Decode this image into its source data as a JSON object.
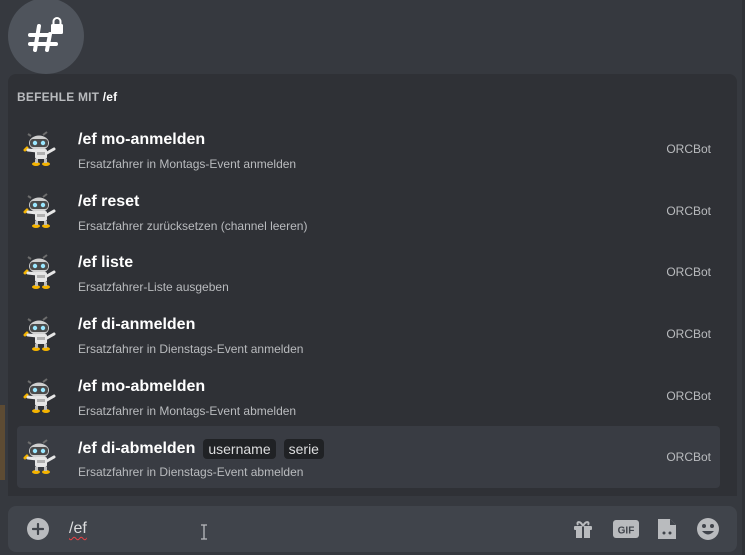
{
  "channel": {
    "icon": "hashtag-lock-icon"
  },
  "popup": {
    "header_prefix": "BEFEHLE MIT",
    "header_query": "/ef",
    "commands": [
      {
        "name": "/ef mo-anmelden",
        "description": "Ersatzfahrer in Montags-Event anmelden",
        "bot": "ORCBot",
        "options": []
      },
      {
        "name": "/ef reset",
        "description": "Ersatzfahrer zurücksetzen (channel leeren)",
        "bot": "ORCBot",
        "options": []
      },
      {
        "name": "/ef liste",
        "description": "Ersatzfahrer-Liste ausgeben",
        "bot": "ORCBot",
        "options": []
      },
      {
        "name": "/ef di-anmelden",
        "description": "Ersatzfahrer in Dienstags-Event anmelden",
        "bot": "ORCBot",
        "options": []
      },
      {
        "name": "/ef mo-abmelden",
        "description": "Ersatzfahrer in Montags-Event abmelden",
        "bot": "ORCBot",
        "options": []
      },
      {
        "name": "/ef di-abmelden",
        "description": "Ersatzfahrer in Dienstags-Event abmelden",
        "bot": "ORCBot",
        "options": [
          "username",
          "serie"
        ],
        "selected": true
      }
    ]
  },
  "composer": {
    "value": "/ef",
    "gif_label": "GIF",
    "icons": [
      "plus-circle-icon",
      "gift-icon",
      "gif-icon",
      "sticker-icon",
      "emoji-icon"
    ]
  },
  "colors": {
    "background": "#36393f",
    "popup": "#2f3136",
    "composer": "#40444b",
    "selected_row": "#393c43"
  }
}
